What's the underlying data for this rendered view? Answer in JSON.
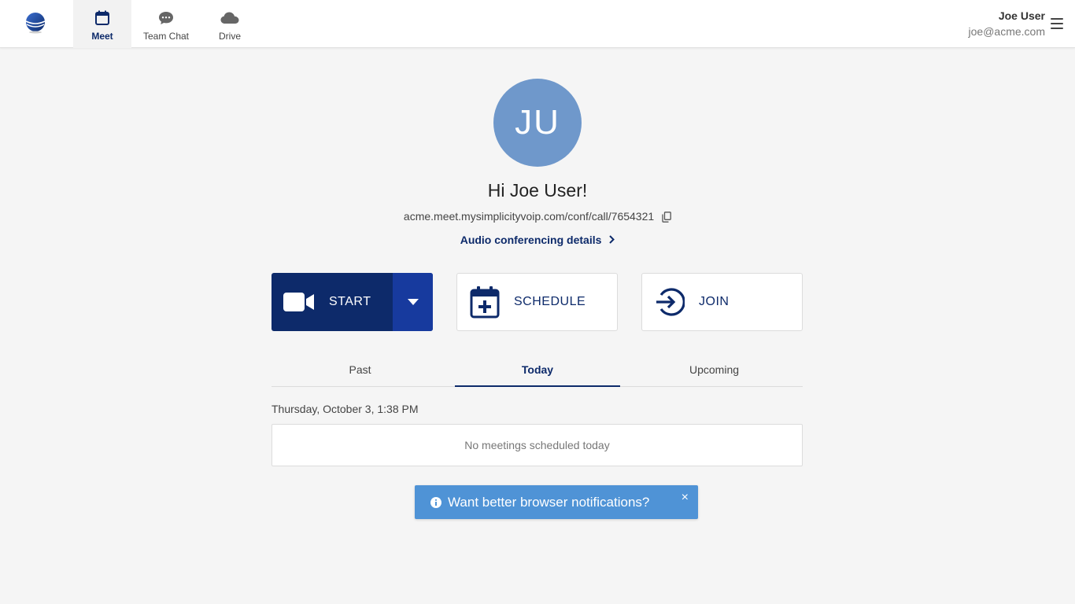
{
  "nav": {
    "items": [
      {
        "label": "Meet",
        "icon": "calendar-icon"
      },
      {
        "label": "Team Chat",
        "icon": "chat-icon"
      },
      {
        "label": "Drive",
        "icon": "cloud-icon"
      }
    ]
  },
  "user": {
    "name": "Joe User",
    "email": "joe@acme.com",
    "initials": "JU"
  },
  "main": {
    "greeting": "Hi Joe User!",
    "meeting_url": "acme.meet.mysimplicityvoip.com/conf/call/7654321",
    "audio_link": "Audio conferencing details"
  },
  "actions": {
    "start": "START",
    "schedule": "SCHEDULE",
    "join": "JOIN"
  },
  "tabs": [
    {
      "label": "Past"
    },
    {
      "label": "Today"
    },
    {
      "label": "Upcoming"
    }
  ],
  "schedule": {
    "date": "Thursday, October 3, 1:38 PM",
    "empty_message": "No meetings scheduled today"
  },
  "toast": {
    "message": "Want better browser notifications?",
    "close": "×"
  },
  "colors": {
    "brand": "#0d2a6a",
    "start_dropdown": "#173a9e",
    "avatar": "#6f98cb",
    "toast": "#4f93d6"
  }
}
